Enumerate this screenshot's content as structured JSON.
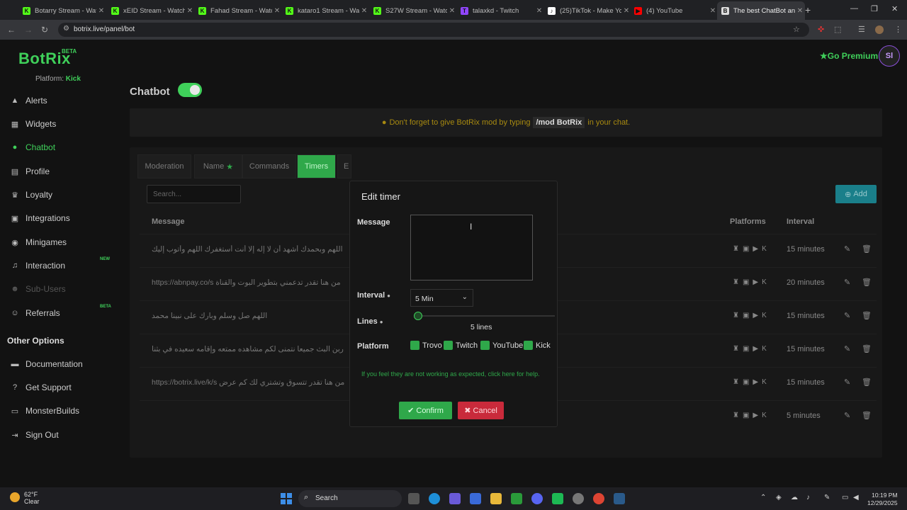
{
  "browser": {
    "tabs": [
      {
        "title": "Botarry Stream - Wat",
        "icon": "K",
        "color": "#53fc18"
      },
      {
        "title": "xEID Stream - Watch",
        "icon": "K",
        "color": "#53fc18"
      },
      {
        "title": "Fahad Stream - Watc",
        "icon": "K",
        "color": "#53fc18"
      },
      {
        "title": "kataro1 Stream - Wat",
        "icon": "K",
        "color": "#53fc18"
      },
      {
        "title": "S27W Stream - Watc",
        "icon": "K",
        "color": "#53fc18"
      },
      {
        "title": "talaxkd - Twitch",
        "icon": "T",
        "color": "#9146ff"
      },
      {
        "title": "(25)TikTok - Make Yo",
        "icon": "♪",
        "color": "#ffffff"
      },
      {
        "title": "(4) YouTube",
        "icon": "▶",
        "color": "#ff0000"
      },
      {
        "title": "The best ChatBot an",
        "icon": "B",
        "color": "#dddddd"
      }
    ],
    "url": "botrix.live/panel/bot"
  },
  "app": {
    "logo": "BotRix",
    "beta": "BETA",
    "platform_label": "Platform:",
    "platform_value": "Kick",
    "go_premium": "Go Premium",
    "avatar": "Sl"
  },
  "sidebar": {
    "items": [
      {
        "label": "Alerts",
        "icon": "alert-icon",
        "glyph": "▲"
      },
      {
        "label": "Widgets",
        "icon": "widgets-icon",
        "glyph": "▦"
      },
      {
        "label": "Chatbot",
        "icon": "chatbot-icon",
        "glyph": "●"
      },
      {
        "label": "Profile",
        "icon": "profile-icon",
        "glyph": "▤"
      },
      {
        "label": "Loyalty",
        "icon": "trophy-icon",
        "glyph": "♛"
      },
      {
        "label": "Integrations",
        "icon": "integrations-icon",
        "glyph": "▣"
      },
      {
        "label": "Minigames",
        "icon": "gamepad-icon",
        "glyph": "◉"
      },
      {
        "label": "Interaction",
        "icon": "music-icon",
        "glyph": "♫",
        "badge": "NEW"
      },
      {
        "label": "Sub-Users",
        "icon": "users-icon",
        "glyph": "☻"
      },
      {
        "label": "Referrals",
        "icon": "referrals-icon",
        "glyph": "☺",
        "badge": "BETA"
      }
    ],
    "other_options": "Other Options",
    "other_items": [
      {
        "label": "Documentation",
        "icon": "book-icon",
        "glyph": "▬"
      },
      {
        "label": "Get Support",
        "icon": "support-icon",
        "glyph": "?"
      },
      {
        "label": "MonsterBuilds",
        "icon": "monitor-icon",
        "glyph": "▭"
      },
      {
        "label": "Sign Out",
        "icon": "sign-out-icon",
        "glyph": "⇥"
      }
    ]
  },
  "main": {
    "title": "Chatbot",
    "notice_pre": "Don't forget to give BotRix mod by typing",
    "notice_code": "/mod BotRix",
    "notice_post": "in your chat.",
    "tabs": [
      "Moderation",
      "Name",
      "Commands",
      "Timers",
      "E"
    ],
    "search_placeholder": "Search...",
    "add_button": "Add",
    "columns": {
      "message": "Message",
      "platforms": "Platforms",
      "interval": "Interval"
    },
    "rows": [
      {
        "message": "اللهم وبحمدك أشهد أن لا إله إلا أنت أستغفرك اللهم وأتوب إليك",
        "interval": "15 minutes"
      },
      {
        "message": "من هنا تقدر تدعمني بتطوير البوت والقناة https://abnpay.co/s",
        "interval": "20 minutes"
      },
      {
        "message": "اللهم صل وسلم وبارك على نبينا محمد",
        "interval": "15 minutes"
      },
      {
        "message": "ربن البث جميعا نتمنى لكم مشاهده ممتعه وإقامه سعيده في بثنا",
        "interval": "15 minutes"
      },
      {
        "message": "من هنا تقدر تتسوق وتشتري لك كم عرض https://botrix.live/k/s",
        "interval": "15 minutes"
      },
      {
        "message": "",
        "interval": "5 minutes"
      }
    ]
  },
  "modal": {
    "title": "Edit timer",
    "message_label": "Message",
    "message_value": "",
    "interval_label": "Interval",
    "interval_value": "5 Min",
    "lines_label": "Lines",
    "lines_value": "5 lines",
    "lines_count": 5,
    "platform_label": "Platform",
    "platforms": [
      "Trovo",
      "Twitch",
      "YouTube",
      "Kick"
    ],
    "help_text": "If you feel they are not working as expected, click here for help.",
    "confirm": "Confirm",
    "cancel": "Cancel"
  },
  "taskbar": {
    "temp": "62°F",
    "weather": "Clear",
    "search": "Search",
    "time": "10:19 PM",
    "date": "12/29/2025"
  },
  "colors": {
    "accent": "#2fa84a",
    "danger": "#c92a3b",
    "brand": "#3fd05a"
  }
}
